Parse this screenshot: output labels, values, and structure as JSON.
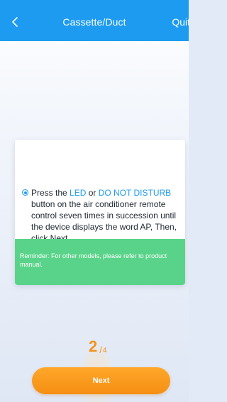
{
  "header": {
    "title": "Cassette/Duct",
    "back_icon": "chevron-left-icon",
    "quit_label": "Quit",
    "background_color": "#1d9bf0"
  },
  "instruction": {
    "text_1": "Press the ",
    "highlight_1": "LED",
    "text_2": " or ",
    "highlight_2": "DO NOT DISTURB",
    "text_3": " button on the air conditioner remote control seven times in succession until the device displays the word AP, Then, click Next.",
    "highlight_color": "#1d9bf0"
  },
  "reminder": {
    "text": "Reminder: For other models, please refer to product manual.",
    "background_color": "#5ad38a"
  },
  "step": {
    "current": "2",
    "separator": "/",
    "total": "4",
    "color": "#f5931e"
  },
  "next_button": {
    "label": "Next",
    "color": "#f7951a"
  }
}
